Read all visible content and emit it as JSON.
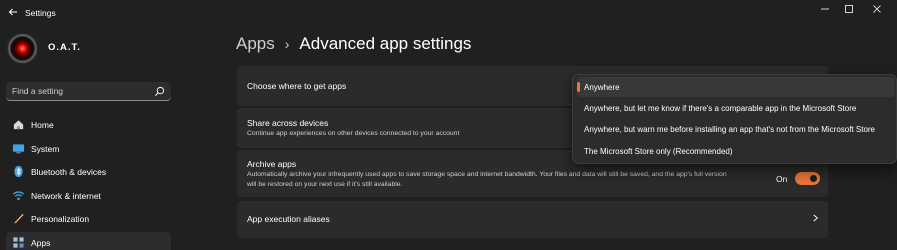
{
  "window": {
    "title": "Settings",
    "controls": [
      "minimize",
      "maximize",
      "close"
    ]
  },
  "user": {
    "name": "O.A.T."
  },
  "search": {
    "placeholder": "Find a setting"
  },
  "sidebar": {
    "items": [
      {
        "label": "Home",
        "icon": "home-icon"
      },
      {
        "label": "System",
        "icon": "system-icon"
      },
      {
        "label": "Bluetooth & devices",
        "icon": "bluetooth-icon"
      },
      {
        "label": "Network & internet",
        "icon": "network-icon"
      },
      {
        "label": "Personalization",
        "icon": "personalization-icon"
      },
      {
        "label": "Apps",
        "icon": "apps-icon",
        "active": true
      }
    ]
  },
  "breadcrumb": {
    "parent": "Apps",
    "separator": "›",
    "current": "Advanced app settings"
  },
  "settings": {
    "choose_where": {
      "title": "Choose where to get apps"
    },
    "share_across": {
      "title": "Share across devices",
      "description": "Continue app experiences on other devices connected to your account"
    },
    "archive": {
      "title": "Archive apps",
      "description_line1": "Automatically archive your infrequently used apps to save storage space and internet bandwidth. Your files and data will still be saved, and the app's full version",
      "description_line2": "will be restored on your next use if it's still available.",
      "toggle_label": "On",
      "toggle_on": true
    },
    "aliases": {
      "title": "App execution aliases"
    }
  },
  "dropdown": {
    "selected_index": 0,
    "options": [
      "Anywhere",
      "Anywhere, but let me know if there's a comparable app in the Microsoft Store",
      "Anywhere, but warn me before installing an app that's not from the Microsoft Store",
      "The Microsoft Store only (Recommended)"
    ]
  },
  "colors": {
    "accent": "#e8743b",
    "background": "#202020",
    "card": "#2b2b2b"
  }
}
